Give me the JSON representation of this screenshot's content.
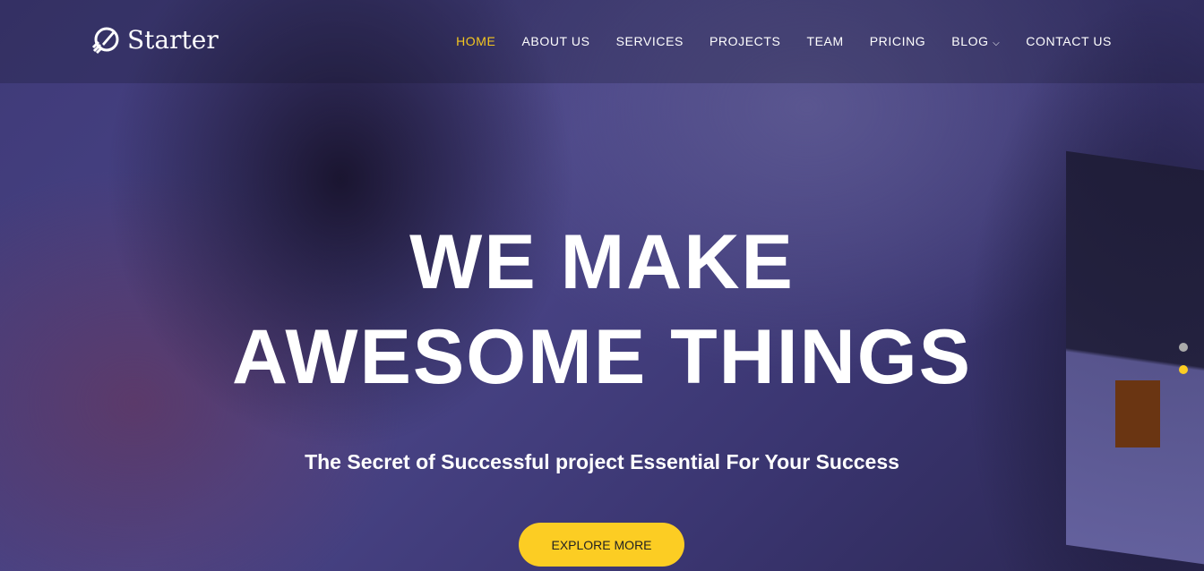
{
  "brand": {
    "name": "Starter",
    "icon": "rocket-icon"
  },
  "nav": {
    "items": [
      {
        "label": "HOME",
        "active": true
      },
      {
        "label": "ABOUT US"
      },
      {
        "label": "SERVICES"
      },
      {
        "label": "PROJECTS"
      },
      {
        "label": "TEAM"
      },
      {
        "label": "PRICING"
      },
      {
        "label": "BLOG"
      },
      {
        "label": "CONTACT US"
      }
    ]
  },
  "hero": {
    "line1": "WE MAKE",
    "line2": "AWESOME THINGS",
    "subtitle": "The Secret of Successful project Essential For Your Success",
    "cta": "EXPLORE MORE"
  },
  "slider": {
    "slides": 2,
    "active": 2
  },
  "colors": {
    "accent": "#fccd23",
    "nav_active": "#f4c620"
  }
}
